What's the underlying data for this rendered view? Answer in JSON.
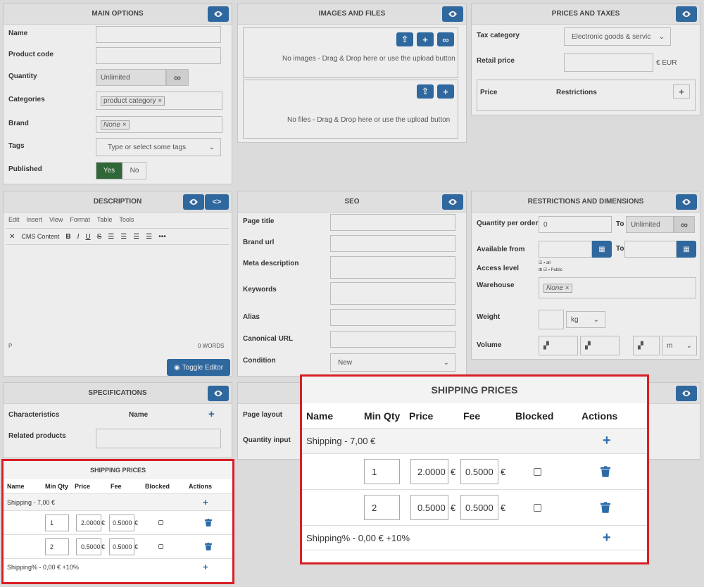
{
  "main_options": {
    "title": "MAIN OPTIONS",
    "name_label": "Name",
    "product_code_label": "Product code",
    "quantity_label": "Quantity",
    "quantity_value": "Unlimited",
    "categories_label": "Categories",
    "category_tag": "product category",
    "brand_label": "Brand",
    "brand_tag": "None",
    "tags_label": "Tags",
    "tags_placeholder": "Type or select some tags",
    "published_label": "Published",
    "yes": "Yes",
    "no": "No"
  },
  "images_files": {
    "title": "IMAGES AND FILES",
    "no_images": "No images - Drag & Drop here or use the upload button",
    "no_files": "No files - Drag & Drop here or use the upload button"
  },
  "prices_taxes": {
    "title": "PRICES AND TAXES",
    "tax_label": "Tax category",
    "tax_value": "Electronic goods & servic",
    "retail_label": "Retail price",
    "currency": "€ EUR",
    "price_col": "Price",
    "restrictions_col": "Restrictions"
  },
  "description": {
    "title": "DESCRIPTION",
    "menu": [
      "Edit",
      "Insert",
      "View",
      "Format",
      "Table",
      "Tools"
    ],
    "cms_content": "CMS Content",
    "status_p": "P",
    "words": "0 WORDS",
    "toggle_editor": "Toggle Editor"
  },
  "seo": {
    "title": "SEO",
    "page_title": "Page title",
    "brand_url": "Brand url",
    "meta_description": "Meta description",
    "keywords": "Keywords",
    "alias": "Alias",
    "canonical_url": "Canonical URL",
    "condition": "Condition",
    "condition_value": "New"
  },
  "restrictions": {
    "title": "RESTRICTIONS AND DIMENSIONS",
    "qty_per_order": "Quantity per order",
    "qty_from": "0",
    "to": "To",
    "unlimited": "Unlimited",
    "available_from": "Available from",
    "access_level": "Access level",
    "access_all": "all",
    "access_public": "Public",
    "warehouse": "Warehouse",
    "warehouse_tag": "None",
    "weight": "Weight",
    "weight_unit": "kg",
    "volume": "Volume",
    "volume_unit": "m"
  },
  "specifications": {
    "title": "SPECIFICATIONS",
    "characteristics": "Characteristics",
    "name_col": "Name",
    "related_products": "Related products"
  },
  "layout_panel": {
    "page_layout": "Page layout",
    "quantity_input": "Quantity input"
  },
  "shipping": {
    "title": "SHIPPING PRICES",
    "headers": [
      "Name",
      "Min Qty",
      "Price",
      "Fee",
      "Blocked",
      "Actions"
    ],
    "groups": [
      {
        "name": "Shipping - 7,00 €",
        "rows": [
          {
            "min_qty": "1",
            "price": "2.0000",
            "fee": "0.5000"
          },
          {
            "min_qty": "2",
            "price": "0.5000",
            "fee": "0.5000"
          }
        ]
      },
      {
        "name": "Shipping% - 0,00 € +10%",
        "rows": []
      }
    ],
    "currency": "€"
  }
}
